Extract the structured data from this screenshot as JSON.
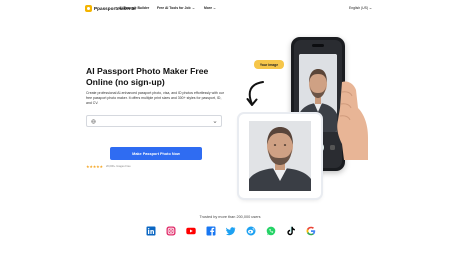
{
  "header": {
    "logo_text": "Ppassportmaker.ai",
    "nav": [
      {
        "label": "AI Resume Builder"
      },
      {
        "label": "Free AI Tools for Job"
      },
      {
        "label": "More"
      }
    ],
    "language": "English (US)"
  },
  "hero": {
    "title": "AI Passport Photo Maker Free Online (no sign-up)",
    "description": "Create professional AI-enhanced passport photo, visa, and ID photos effortlessly with our free passport photo maker. It offers multiple print sizes and 300+ styles for passport, ID, and CV.",
    "select_value": "",
    "cta_label": "Make Passport Photo Now",
    "stars": "★★★★★",
    "rating_text": "20,000+ Images Free"
  },
  "illustration": {
    "badge_label": "Your image"
  },
  "footer": {
    "trusted_text": "Trusted by more than 200,000 users",
    "socials": [
      {
        "name": "linkedin-icon",
        "color": "#0a66c2"
      },
      {
        "name": "instagram-icon",
        "color": "#e1306c"
      },
      {
        "name": "youtube-icon",
        "color": "#ff0000"
      },
      {
        "name": "facebook-icon",
        "color": "#1877f2"
      },
      {
        "name": "twitter-icon",
        "color": "#1da1f2"
      },
      {
        "name": "weibo-icon",
        "color": "#1da1f2"
      },
      {
        "name": "whatsapp-icon",
        "color": "#25d366"
      },
      {
        "name": "tiktok-icon",
        "color": "#000000"
      },
      {
        "name": "google-icon",
        "color": "#4285f4"
      }
    ]
  },
  "colors": {
    "accent": "#2f6cf2",
    "badge": "#f6c64a",
    "stars": "#f5a623"
  }
}
